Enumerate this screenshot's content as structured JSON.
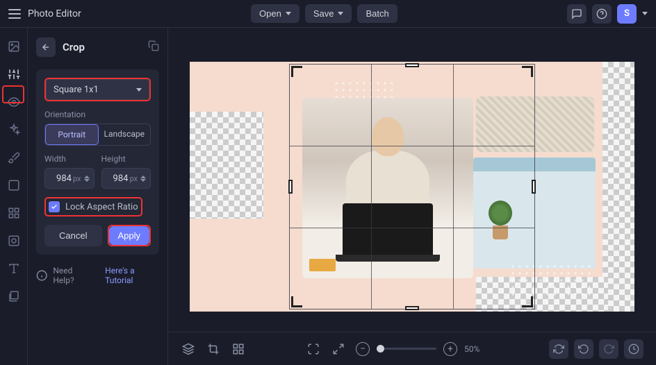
{
  "app": {
    "title": "Photo Editor"
  },
  "topbar": {
    "open": "Open",
    "save": "Save",
    "batch": "Batch",
    "avatar_letter": "S"
  },
  "panel": {
    "title": "Crop",
    "ratio_selected": "Square 1x1",
    "orientation_label": "Orientation",
    "orientation_portrait": "Portrait",
    "orientation_landscape": "Landscape",
    "width_label": "Width",
    "height_label": "Height",
    "width_value": "984",
    "height_value": "984",
    "unit": "px",
    "lock_aspect_label": "Lock Aspect Ratio",
    "cancel": "Cancel",
    "apply": "Apply",
    "help_text": "Need Help?",
    "help_link": "Here's a Tutorial"
  },
  "zoom": {
    "percent": "50%"
  }
}
